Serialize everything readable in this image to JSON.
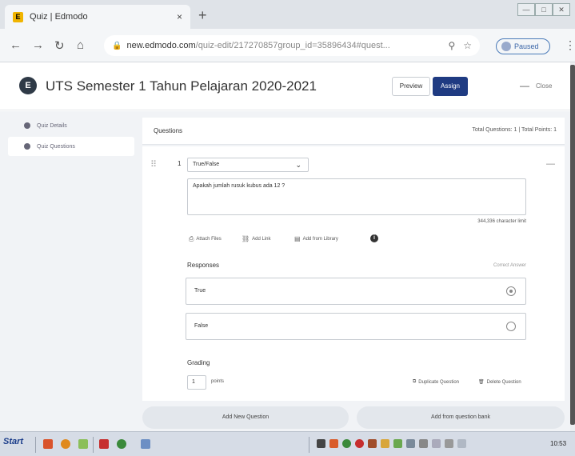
{
  "browser": {
    "tab_title": "Quiz | Edmodo",
    "favicon_letter": "E",
    "tab_close": "×",
    "new_tab": "+",
    "window_controls": [
      "—",
      "□",
      "✕"
    ],
    "url_main": "new.edmodo.com",
    "url_rest": "/quiz-edit/217270857group_id=35896434#quest...",
    "profile_status": "Paused",
    "nav_icons": [
      "back-icon",
      "forward-icon",
      "reload-icon",
      "home-icon"
    ]
  },
  "header": {
    "logo_letter": "E",
    "title": "UTS Semester 1 Tahun Pelajaran 2020-2021",
    "assign_label": "Assign",
    "preview_label": "Preview",
    "dash": "—",
    "close_label": "Close"
  },
  "sidebar": {
    "items": [
      {
        "label": "Quiz Details"
      },
      {
        "label": "Quiz Questions"
      }
    ]
  },
  "questions": {
    "heading": "Questions",
    "totals": "Total Questions: 1  |  Total Points: 1",
    "number": "1",
    "type": "True/False",
    "text": "Apakah jumlah rusuk kubus ada 12 ?",
    "char_count": "344,336 character limit",
    "attach": [
      "Attach Files",
      "Add Link",
      "Add from Library"
    ],
    "responses_label": "Responses",
    "correct_answer_label": "Correct Answer",
    "options": [
      {
        "label": "True",
        "selected": true
      },
      {
        "label": "False",
        "selected": false
      }
    ],
    "grading_label": "Grading",
    "points_value": "1",
    "points_label": "points",
    "duplicate_label": "Duplicate Question",
    "delete_label": "Delete Question"
  },
  "actions": {
    "add_new": "Add New Question",
    "add_bank": "Add from question bank"
  },
  "taskbar": {
    "start_label": "Start",
    "clock": "10:53"
  },
  "colors": {
    "assign_bg": "#1f3b82",
    "sidebar_bg": "#f1f3f6",
    "brand_dark": "#2f3a47"
  }
}
